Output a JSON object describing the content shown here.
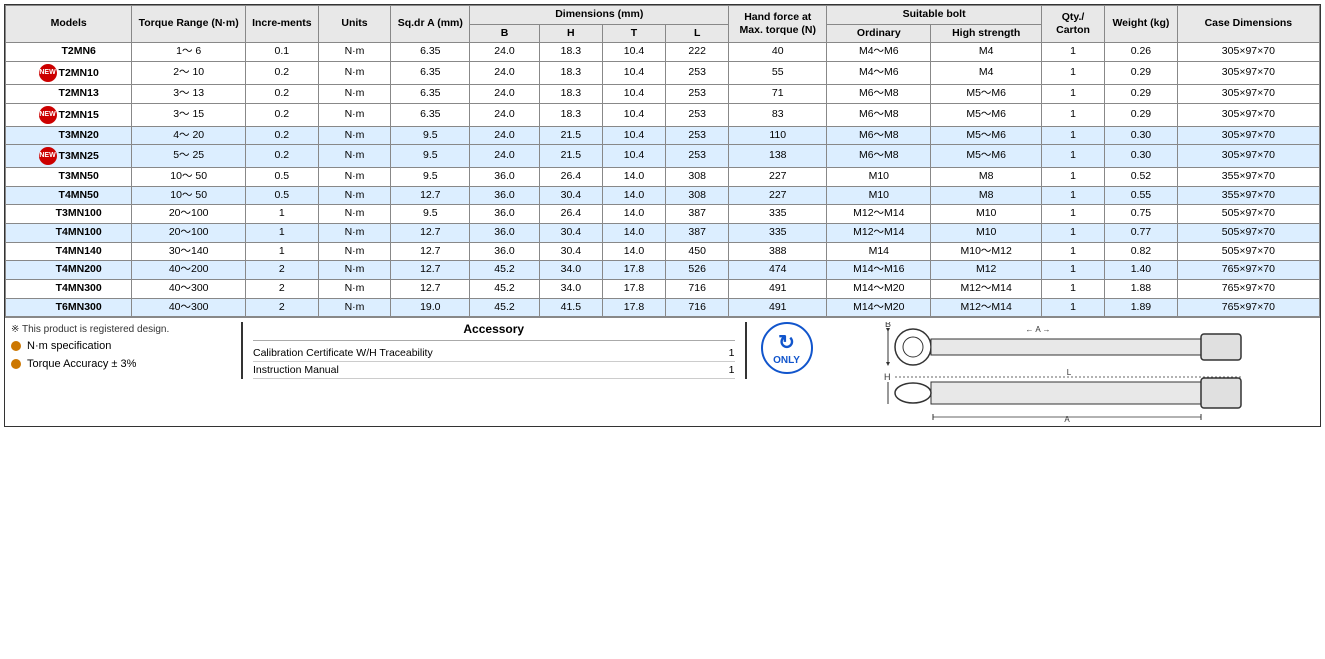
{
  "table": {
    "headers": {
      "models": "Models",
      "torque_range": "Torque Range (N·m)",
      "increments": "Incre-ments",
      "units": "Units",
      "sqdr_a": "Sq.dr A (mm)",
      "dimensions": "Dimensions (mm)",
      "dim_b": "B",
      "dim_h": "H",
      "dim_t": "T",
      "dim_l": "L",
      "hand_force": "Hand force at Max. torque (N)",
      "suitable_bolt": "Suitable bolt",
      "ordinary": "Ordinary",
      "high_strength": "High strength",
      "qty_carton": "Qty./ Carton",
      "weight": "Weight (kg)",
      "case_dimensions": "Case Dimensions"
    },
    "rows": [
      {
        "model": "T2MN6",
        "new": false,
        "torque": "1～  6",
        "incr": "0.1",
        "units": "N·m",
        "sqdr": "6.35",
        "b": "24.0",
        "h": "18.3",
        "t": "10.4",
        "l": "222",
        "hand": "40",
        "ordinary": "M4～M6",
        "high": "M4",
        "qty": "1",
        "weight": "0.26",
        "case": "305×97×70",
        "highlight": false
      },
      {
        "model": "T2MN10",
        "new": true,
        "torque": "2～ 10",
        "incr": "0.2",
        "units": "N·m",
        "sqdr": "6.35",
        "b": "24.0",
        "h": "18.3",
        "t": "10.4",
        "l": "253",
        "hand": "55",
        "ordinary": "M4～M6",
        "high": "M4",
        "qty": "1",
        "weight": "0.29",
        "case": "305×97×70",
        "highlight": false
      },
      {
        "model": "T2MN13",
        "new": false,
        "torque": "3～ 13",
        "incr": "0.2",
        "units": "N·m",
        "sqdr": "6.35",
        "b": "24.0",
        "h": "18.3",
        "t": "10.4",
        "l": "253",
        "hand": "71",
        "ordinary": "M6～M8",
        "high": "M5～M6",
        "qty": "1",
        "weight": "0.29",
        "case": "305×97×70",
        "highlight": false
      },
      {
        "model": "T2MN15",
        "new": true,
        "torque": "3～ 15",
        "incr": "0.2",
        "units": "N·m",
        "sqdr": "6.35",
        "b": "24.0",
        "h": "18.3",
        "t": "10.4",
        "l": "253",
        "hand": "83",
        "ordinary": "M6～M8",
        "high": "M5～M6",
        "qty": "1",
        "weight": "0.29",
        "case": "305×97×70",
        "highlight": false
      },
      {
        "model": "T3MN20",
        "new": false,
        "torque": "4～ 20",
        "incr": "0.2",
        "units": "N·m",
        "sqdr": "9.5",
        "b": "24.0",
        "h": "21.5",
        "t": "10.4",
        "l": "253",
        "hand": "110",
        "ordinary": "M6～M8",
        "high": "M5～M6",
        "qty": "1",
        "weight": "0.30",
        "case": "305×97×70",
        "highlight": true
      },
      {
        "model": "T3MN25",
        "new": true,
        "torque": "5～ 25",
        "incr": "0.2",
        "units": "N·m",
        "sqdr": "9.5",
        "b": "24.0",
        "h": "21.5",
        "t": "10.4",
        "l": "253",
        "hand": "138",
        "ordinary": "M6～M8",
        "high": "M5～M6",
        "qty": "1",
        "weight": "0.30",
        "case": "305×97×70",
        "highlight": true
      },
      {
        "model": "T3MN50",
        "new": false,
        "torque": "10～ 50",
        "incr": "0.5",
        "units": "N·m",
        "sqdr": "9.5",
        "b": "36.0",
        "h": "26.4",
        "t": "14.0",
        "l": "308",
        "hand": "227",
        "ordinary": "M10",
        "high": "M8",
        "qty": "1",
        "weight": "0.52",
        "case": "355×97×70",
        "highlight": false
      },
      {
        "model": "T4MN50",
        "new": false,
        "torque": "10～ 50",
        "incr": "0.5",
        "units": "N·m",
        "sqdr": "12.7",
        "b": "36.0",
        "h": "30.4",
        "t": "14.0",
        "l": "308",
        "hand": "227",
        "ordinary": "M10",
        "high": "M8",
        "qty": "1",
        "weight": "0.55",
        "case": "355×97×70",
        "highlight": true
      },
      {
        "model": "T3MN100",
        "new": false,
        "torque": "20～100",
        "incr": "1",
        "units": "N·m",
        "sqdr": "9.5",
        "b": "36.0",
        "h": "26.4",
        "t": "14.0",
        "l": "387",
        "hand": "335",
        "ordinary": "M12～M14",
        "high": "M10",
        "qty": "1",
        "weight": "0.75",
        "case": "505×97×70",
        "highlight": false
      },
      {
        "model": "T4MN100",
        "new": false,
        "torque": "20～100",
        "incr": "1",
        "units": "N·m",
        "sqdr": "12.7",
        "b": "36.0",
        "h": "30.4",
        "t": "14.0",
        "l": "387",
        "hand": "335",
        "ordinary": "M12～M14",
        "high": "M10",
        "qty": "1",
        "weight": "0.77",
        "case": "505×97×70",
        "highlight": true
      },
      {
        "model": "T4MN140",
        "new": false,
        "torque": "30～140",
        "incr": "1",
        "units": "N·m",
        "sqdr": "12.7",
        "b": "36.0",
        "h": "30.4",
        "t": "14.0",
        "l": "450",
        "hand": "388",
        "ordinary": "M14",
        "high": "M10～M12",
        "qty": "1",
        "weight": "0.82",
        "case": "505×97×70",
        "highlight": false
      },
      {
        "model": "T4MN200",
        "new": false,
        "torque": "40～200",
        "incr": "2",
        "units": "N·m",
        "sqdr": "12.7",
        "b": "45.2",
        "h": "34.0",
        "t": "17.8",
        "l": "526",
        "hand": "474",
        "ordinary": "M14～M16",
        "high": "M12",
        "qty": "1",
        "weight": "1.40",
        "case": "765×97×70",
        "highlight": true
      },
      {
        "model": "T4MN300",
        "new": false,
        "torque": "40～300",
        "incr": "2",
        "units": "N·m",
        "sqdr": "12.7",
        "b": "45.2",
        "h": "34.0",
        "t": "17.8",
        "l": "716",
        "hand": "491",
        "ordinary": "M14～M20",
        "high": "M12～M14",
        "qty": "1",
        "weight": "1.88",
        "case": "765×97×70",
        "highlight": false
      },
      {
        "model": "T6MN300",
        "new": false,
        "torque": "40～300",
        "incr": "2",
        "units": "N·m",
        "sqdr": "19.0",
        "b": "45.2",
        "h": "41.5",
        "t": "17.8",
        "l": "716",
        "hand": "491",
        "ordinary": "M14～M20",
        "high": "M12～M14",
        "qty": "1",
        "weight": "1.89",
        "case": "765×97×70",
        "highlight": true
      }
    ]
  },
  "note": "※ This product is registered design.",
  "specs": [
    {
      "label": "N·m specification"
    },
    {
      "label": "Torque Accuracy ± 3%"
    }
  ],
  "accessory": {
    "title": "Accessory",
    "items": [
      {
        "name": "Calibration Certificate W/H Traceability",
        "qty": "1"
      },
      {
        "name": "Instruction Manual",
        "qty": "1"
      }
    ]
  },
  "only_badge": "ONLY",
  "diagram": {
    "label_b": "B",
    "label_h": "H",
    "label_a": "A",
    "label_l": "L"
  }
}
